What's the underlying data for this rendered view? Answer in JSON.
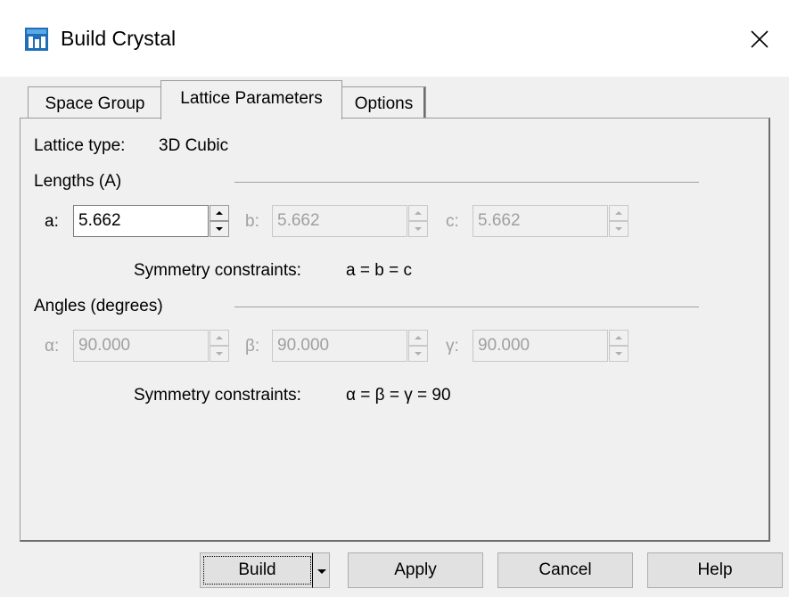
{
  "window": {
    "title": "Build Crystal",
    "icon": "app-icon",
    "close_icon": "close-icon"
  },
  "tabs": [
    {
      "label": "Space Group",
      "active": false
    },
    {
      "label": "Lattice Parameters",
      "active": true
    },
    {
      "label": "Options",
      "active": false
    }
  ],
  "lattice": {
    "type_label": "Lattice type:",
    "type_value": "3D Cubic"
  },
  "lengths": {
    "heading": "Lengths (A)",
    "a_label": "a:",
    "a_value": "5.662",
    "b_label": "b:",
    "b_value": "5.662",
    "c_label": "c:",
    "c_value": "5.662",
    "constraint_label": "Symmetry constraints:",
    "constraint_value": "a = b = c"
  },
  "angles": {
    "heading": "Angles (degrees)",
    "alpha_label": "α:",
    "alpha_value": "90.000",
    "beta_label": "β:",
    "beta_value": "90.000",
    "gamma_label": "γ:",
    "gamma_value": "90.000",
    "constraint_label": "Symmetry constraints:",
    "constraint_value": "α = β = γ = 90"
  },
  "buttons": {
    "build": "Build",
    "apply": "Apply",
    "cancel": "Cancel",
    "help": "Help"
  }
}
